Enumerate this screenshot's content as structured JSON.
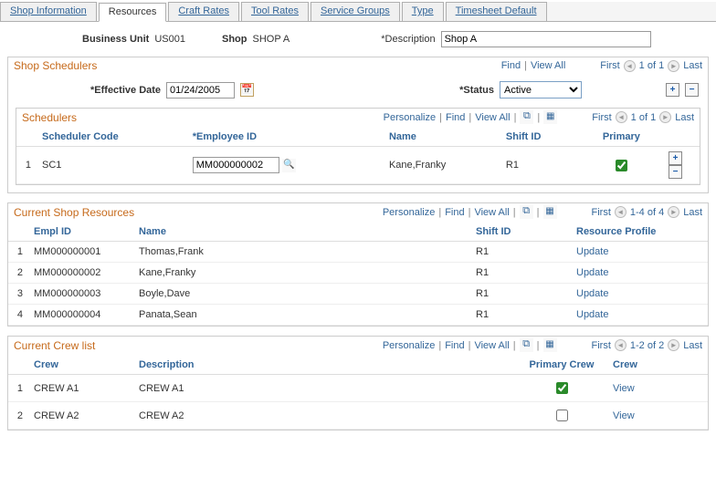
{
  "tabs": {
    "shop_information": "Shop Information",
    "resources": "Resources",
    "craft_rates": "Craft Rates",
    "tool_rates": "Tool Rates",
    "service_groups": "Service Groups",
    "type": "Type",
    "timesheet_default": "Timesheet Default"
  },
  "header": {
    "bu_label": "Business Unit",
    "bu_value": "US001",
    "shop_label": "Shop",
    "shop_value": "SHOP A",
    "desc_label": "*Description",
    "desc_value": "Shop A"
  },
  "common": {
    "find": "Find",
    "view_all": "View All",
    "first": "First",
    "last": "Last",
    "personalize": "Personalize"
  },
  "shop_schedulers": {
    "title": "Shop Schedulers",
    "page_info": "1 of 1",
    "effective_date_label": "*Effective Date",
    "effective_date_value": "01/24/2005",
    "status_label": "*Status",
    "status_value": "Active",
    "schedulers": {
      "title": "Schedulers",
      "page_info": "1 of 1",
      "columns": {
        "scheduler_code": "Scheduler Code",
        "employee_id": "*Employee ID",
        "name": "Name",
        "shift_id": "Shift ID",
        "primary": "Primary"
      },
      "rows": [
        {
          "num": "1",
          "scheduler_code": "SC1",
          "employee_id": "MM000000002",
          "name": "Kane,Franky",
          "shift_id": "R1",
          "primary": true
        }
      ]
    }
  },
  "current_shop_resources": {
    "title": "Current Shop Resources",
    "page_info": "1-4 of 4",
    "columns": {
      "empl_id": "Empl ID",
      "name": "Name",
      "shift_id": "Shift ID",
      "resource_profile": "Resource Profile"
    },
    "update_label": "Update",
    "rows": [
      {
        "num": "1",
        "empl_id": "MM000000001",
        "name": "Thomas,Frank",
        "shift_id": "R1"
      },
      {
        "num": "2",
        "empl_id": "MM000000002",
        "name": "Kane,Franky",
        "shift_id": "R1"
      },
      {
        "num": "3",
        "empl_id": "MM000000003",
        "name": "Boyle,Dave",
        "shift_id": "R1"
      },
      {
        "num": "4",
        "empl_id": "MM000000004",
        "name": "Panata,Sean",
        "shift_id": "R1"
      }
    ]
  },
  "current_crew_list": {
    "title": "Current Crew list",
    "page_info": "1-2 of 2",
    "columns": {
      "crew": "Crew",
      "description": "Description",
      "primary_crew": "Primary Crew",
      "crew_link": "Crew"
    },
    "view_label": "View",
    "rows": [
      {
        "num": "1",
        "crew": "CREW A1",
        "description": "CREW A1",
        "primary": true
      },
      {
        "num": "2",
        "crew": "CREW A2",
        "description": "CREW A2",
        "primary": false
      }
    ]
  }
}
